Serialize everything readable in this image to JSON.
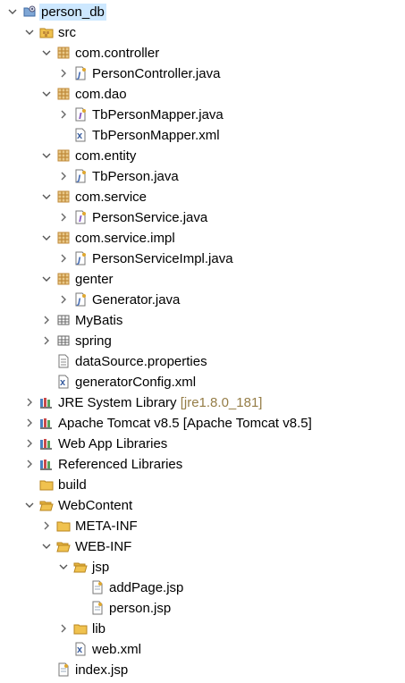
{
  "colors": {
    "decoration": "#957d47",
    "selection": "#cde8ff",
    "folder": "#f0c24f",
    "package": "#c08a3a",
    "java_file": "#4a6fb5"
  },
  "tree": [
    {
      "label": "person_db",
      "level": 0,
      "twisty": "down",
      "icon": "project-icon",
      "selected": true
    },
    {
      "label": "src",
      "level": 1,
      "twisty": "down",
      "icon": "source-folder-icon"
    },
    {
      "label": "com.controller",
      "level": 2,
      "twisty": "down",
      "icon": "package-icon"
    },
    {
      "label": "PersonController.java",
      "level": 3,
      "twisty": "right",
      "icon": "java-file-icon"
    },
    {
      "label": "com.dao",
      "level": 2,
      "twisty": "down",
      "icon": "package-icon"
    },
    {
      "label": "TbPersonMapper.java",
      "level": 3,
      "twisty": "right",
      "icon": "java-interface-icon"
    },
    {
      "label": "TbPersonMapper.xml",
      "level": 3,
      "twisty": "none",
      "icon": "xml-file-icon"
    },
    {
      "label": "com.entity",
      "level": 2,
      "twisty": "down",
      "icon": "package-icon"
    },
    {
      "label": "TbPerson.java",
      "level": 3,
      "twisty": "right",
      "icon": "java-file-icon"
    },
    {
      "label": "com.service",
      "level": 2,
      "twisty": "down",
      "icon": "package-icon"
    },
    {
      "label": "PersonService.java",
      "level": 3,
      "twisty": "right",
      "icon": "java-interface-icon"
    },
    {
      "label": "com.service.impl",
      "level": 2,
      "twisty": "down",
      "icon": "package-icon"
    },
    {
      "label": "PersonServiceImpl.java",
      "level": 3,
      "twisty": "right",
      "icon": "java-file-icon"
    },
    {
      "label": "genter",
      "level": 2,
      "twisty": "down",
      "icon": "package-icon"
    },
    {
      "label": "Generator.java",
      "level": 3,
      "twisty": "right",
      "icon": "java-file-icon"
    },
    {
      "label": "MyBatis",
      "level": 2,
      "twisty": "right",
      "icon": "folder-package-icon"
    },
    {
      "label": "spring",
      "level": 2,
      "twisty": "right",
      "icon": "folder-package-icon"
    },
    {
      "label": "dataSource.properties",
      "level": 2,
      "twisty": "none",
      "icon": "properties-file-icon"
    },
    {
      "label": "generatorConfig.xml",
      "level": 2,
      "twisty": "none",
      "icon": "xml-file-icon"
    },
    {
      "label": "JRE System Library",
      "decoration": " [jre1.8.0_181]",
      "level": 1,
      "twisty": "right",
      "icon": "library-icon"
    },
    {
      "label": "Apache Tomcat v8.5 [Apache Tomcat v8.5]",
      "level": 1,
      "twisty": "right",
      "icon": "library-icon"
    },
    {
      "label": "Web App Libraries",
      "level": 1,
      "twisty": "right",
      "icon": "library-icon"
    },
    {
      "label": "Referenced Libraries",
      "level": 1,
      "twisty": "right",
      "icon": "library-icon"
    },
    {
      "label": "build",
      "level": 1,
      "twisty": "none",
      "icon": "folder-icon"
    },
    {
      "label": "WebContent",
      "level": 1,
      "twisty": "down",
      "icon": "folder-open-icon"
    },
    {
      "label": "META-INF",
      "level": 2,
      "twisty": "right",
      "icon": "folder-icon"
    },
    {
      "label": "WEB-INF",
      "level": 2,
      "twisty": "down",
      "icon": "folder-open-icon"
    },
    {
      "label": "jsp",
      "level": 3,
      "twisty": "down",
      "icon": "folder-open-icon"
    },
    {
      "label": "addPage.jsp",
      "level": 4,
      "twisty": "none",
      "icon": "jsp-file-icon"
    },
    {
      "label": "person.jsp",
      "level": 4,
      "twisty": "none",
      "icon": "jsp-file-icon"
    },
    {
      "label": "lib",
      "level": 3,
      "twisty": "right",
      "icon": "folder-icon"
    },
    {
      "label": "web.xml",
      "level": 3,
      "twisty": "none",
      "icon": "xml-file-icon"
    },
    {
      "label": "index.jsp",
      "level": 2,
      "twisty": "none",
      "icon": "jsp-file-icon"
    }
  ]
}
